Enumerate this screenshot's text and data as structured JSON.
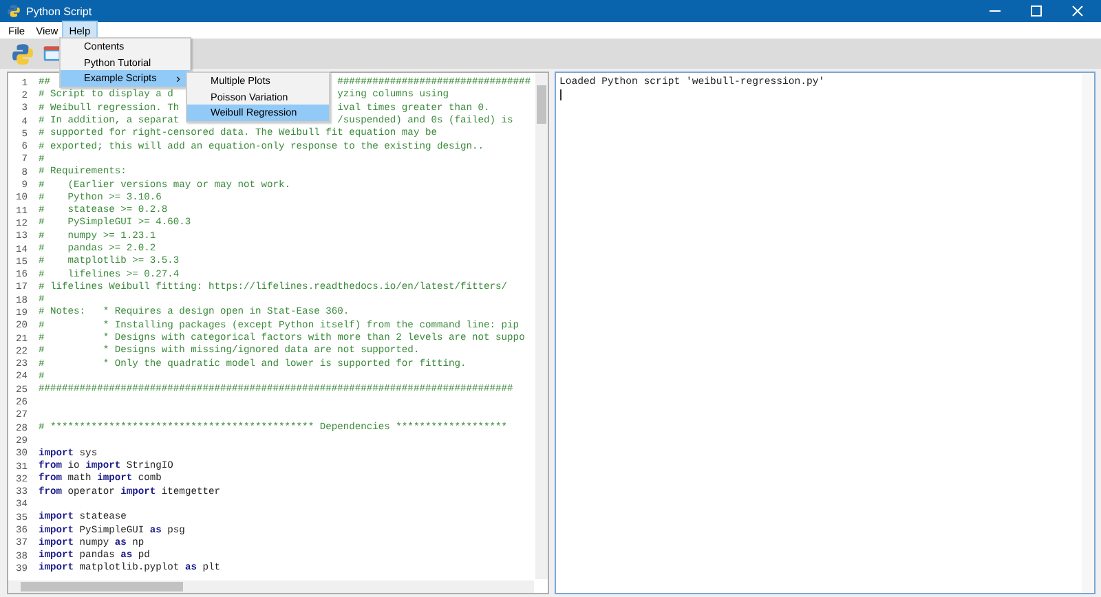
{
  "window": {
    "title": "Python Script"
  },
  "menu_bar": [
    {
      "label": "File",
      "selected": false
    },
    {
      "label": "View",
      "selected": false
    },
    {
      "label": "Help",
      "selected": true
    }
  ],
  "help_menu": [
    {
      "label": "Contents",
      "selected": false
    },
    {
      "label": "Python Tutorial",
      "selected": false
    },
    {
      "label": "Example Scripts",
      "selected": true,
      "arrow": "›"
    }
  ],
  "example_scripts_menu": [
    {
      "label": "Multiple Plots",
      "selected": false
    },
    {
      "label": "Poisson Variation",
      "selected": false
    },
    {
      "label": "Weibull Regression",
      "selected": true
    }
  ],
  "code_lines": [
    {
      "num": "1",
      "segments": [
        {
          "kind": "comment",
          "text": "##"
        }
      ],
      "after_menu": "#################################"
    },
    {
      "num": "2",
      "segments": [
        {
          "kind": "comment",
          "text": "# Script to display a d"
        }
      ],
      "after_menu": "yzing columns using"
    },
    {
      "num": "3",
      "segments": [
        {
          "kind": "comment",
          "text": "# Weibull regression. Th"
        }
      ],
      "after_menu": "ival times greater than 0."
    },
    {
      "num": "4",
      "segments": [
        {
          "kind": "comment",
          "text": "# In addition, a separat"
        }
      ],
      "after_menu": "/suspended) and 0s (failed) is"
    },
    {
      "num": "5",
      "segments": [
        {
          "kind": "comment",
          "text": "# supported for right-censored data. The Weibull fit equation may be"
        }
      ]
    },
    {
      "num": "6",
      "segments": [
        {
          "kind": "comment",
          "text": "# exported; this will add an equation-only response to the existing design.."
        }
      ]
    },
    {
      "num": "7",
      "segments": [
        {
          "kind": "comment",
          "text": "#"
        }
      ]
    },
    {
      "num": "8",
      "segments": [
        {
          "kind": "comment",
          "text": "# Requirements:"
        }
      ]
    },
    {
      "num": "9",
      "segments": [
        {
          "kind": "comment",
          "text": "#    (Earlier versions may or may not work."
        }
      ]
    },
    {
      "num": "10",
      "segments": [
        {
          "kind": "comment",
          "text": "#    Python >= 3.10.6"
        }
      ]
    },
    {
      "num": "11",
      "segments": [
        {
          "kind": "comment",
          "text": "#    statease >= 0.2.8"
        }
      ]
    },
    {
      "num": "12",
      "segments": [
        {
          "kind": "comment",
          "text": "#    PySimpleGUI >= 4.60.3"
        }
      ]
    },
    {
      "num": "13",
      "segments": [
        {
          "kind": "comment",
          "text": "#    numpy >= 1.23.1"
        }
      ]
    },
    {
      "num": "14",
      "segments": [
        {
          "kind": "comment",
          "text": "#    pandas >= 2.0.2"
        }
      ]
    },
    {
      "num": "15",
      "segments": [
        {
          "kind": "comment",
          "text": "#    matplotlib >= 3.5.3"
        }
      ]
    },
    {
      "num": "16",
      "segments": [
        {
          "kind": "comment",
          "text": "#    lifelines >= 0.27.4"
        }
      ]
    },
    {
      "num": "17",
      "segments": [
        {
          "kind": "comment",
          "text": "# lifelines Weibull fitting: https://lifelines.readthedocs.io/en/latest/fitters/"
        }
      ]
    },
    {
      "num": "18",
      "segments": [
        {
          "kind": "comment",
          "text": "#"
        }
      ]
    },
    {
      "num": "19",
      "segments": [
        {
          "kind": "comment",
          "text": "# Notes:   * Requires a design open in Stat-Ease 360."
        }
      ]
    },
    {
      "num": "20",
      "segments": [
        {
          "kind": "comment",
          "text": "#          * Installing packages (except Python itself) from the command line: pip"
        }
      ]
    },
    {
      "num": "21",
      "segments": [
        {
          "kind": "comment",
          "text": "#          * Designs with categorical factors with more than 2 levels are not suppo"
        }
      ]
    },
    {
      "num": "22",
      "segments": [
        {
          "kind": "comment",
          "text": "#          * Designs with missing/ignored data are not supported."
        }
      ]
    },
    {
      "num": "23",
      "segments": [
        {
          "kind": "comment",
          "text": "#          * Only the quadratic model and lower is supported for fitting."
        }
      ]
    },
    {
      "num": "24",
      "segments": [
        {
          "kind": "comment",
          "text": "#"
        }
      ]
    },
    {
      "num": "25",
      "segments": [
        {
          "kind": "comment",
          "text": "#################################################################################"
        }
      ]
    },
    {
      "num": "26"
    },
    {
      "num": "27"
    },
    {
      "num": "28",
      "segments": [
        {
          "kind": "comment",
          "text": "# ********************************************* Dependencies *******************"
        }
      ]
    },
    {
      "num": "29"
    },
    {
      "num": "30",
      "segments": [
        {
          "kind": "keyword",
          "text": "import"
        },
        {
          "kind": "plain",
          "text": " sys"
        }
      ]
    },
    {
      "num": "31",
      "segments": [
        {
          "kind": "keyword",
          "text": "from"
        },
        {
          "kind": "plain",
          "text": " io "
        },
        {
          "kind": "keyword",
          "text": "import"
        },
        {
          "kind": "plain",
          "text": " StringIO"
        }
      ]
    },
    {
      "num": "32",
      "segments": [
        {
          "kind": "keyword",
          "text": "from"
        },
        {
          "kind": "plain",
          "text": " math "
        },
        {
          "kind": "keyword",
          "text": "import"
        },
        {
          "kind": "plain",
          "text": " comb"
        }
      ]
    },
    {
      "num": "33",
      "segments": [
        {
          "kind": "keyword",
          "text": "from"
        },
        {
          "kind": "plain",
          "text": " operator "
        },
        {
          "kind": "keyword",
          "text": "import"
        },
        {
          "kind": "plain",
          "text": " itemgetter"
        }
      ]
    },
    {
      "num": "34"
    },
    {
      "num": "35",
      "segments": [
        {
          "kind": "keyword",
          "text": "import"
        },
        {
          "kind": "plain",
          "text": " statease"
        }
      ]
    },
    {
      "num": "36",
      "segments": [
        {
          "kind": "keyword",
          "text": "import"
        },
        {
          "kind": "plain",
          "text": " PySimpleGUI "
        },
        {
          "kind": "keyword",
          "text": "as"
        },
        {
          "kind": "plain",
          "text": " psg"
        }
      ]
    },
    {
      "num": "37",
      "segments": [
        {
          "kind": "keyword",
          "text": "import"
        },
        {
          "kind": "plain",
          "text": " numpy "
        },
        {
          "kind": "keyword",
          "text": "as"
        },
        {
          "kind": "plain",
          "text": " np"
        }
      ]
    },
    {
      "num": "38",
      "segments": [
        {
          "kind": "keyword",
          "text": "import"
        },
        {
          "kind": "plain",
          "text": " pandas "
        },
        {
          "kind": "keyword",
          "text": "as"
        },
        {
          "kind": "plain",
          "text": " pd"
        }
      ]
    },
    {
      "num": "39",
      "segments": [
        {
          "kind": "keyword",
          "text": "import"
        },
        {
          "kind": "plain",
          "text": " matplotlib.pyplot "
        },
        {
          "kind": "keyword",
          "text": "as"
        },
        {
          "kind": "plain",
          "text": " plt"
        }
      ]
    }
  ],
  "output": {
    "text": "Loaded Python script 'weibull-regression.py'"
  }
}
